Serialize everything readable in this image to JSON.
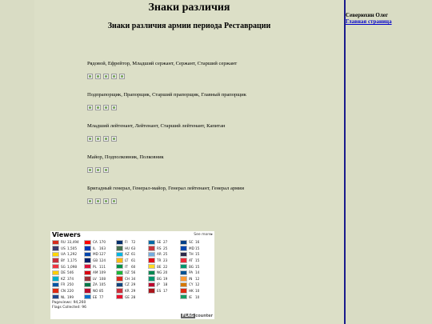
{
  "page": {
    "title": "Знаки различия",
    "subtitle": "Знаки различия армии периода Реставрации"
  },
  "sidebar": {
    "author": "Северюхин Олег",
    "home_link": "Главная страница"
  },
  "ranks": [
    {
      "text": "Рядовой, Ефрейтор, Младший сержант, Сержант, Старший сержант",
      "images": 5
    },
    {
      "text": "Подпрапорщик, Прапорщик, Старший прапорщик, Главный прапорщик",
      "images": 4
    },
    {
      "text": "Младший лейтенант, Лейтенант, Старший лейтенант, Капитан",
      "images": 4
    },
    {
      "text": "Майор, Подполковник, Полковник",
      "images": 3
    },
    {
      "text": "Бригадный генерал, Генерал-майор, Генерал лейтенант, Генерал армии",
      "images": 4
    }
  ],
  "flag_counter": {
    "title": "Viewers",
    "see_more": "See more▸",
    "pageviews_label": "Pageviews:",
    "pageviews": "94,260",
    "flags_label": "Flags Collected:",
    "flags_collected": "96",
    "brand": "FLAG",
    "brand2": "counter",
    "columns": [
      [
        {
          "code": "RU",
          "count": "33,494",
          "color": "#d52b1e"
        },
        {
          "code": "US",
          "count": "1,505",
          "color": "#3c3b6e"
        },
        {
          "code": "UA",
          "count": "1,292",
          "color": "#ffd500"
        },
        {
          "code": "BY",
          "count": "1,175",
          "color": "#c8313e"
        },
        {
          "code": "SG",
          "count": "1,098",
          "color": "#ef3340"
        },
        {
          "code": "DE",
          "count": "546",
          "color": "#ffce00"
        },
        {
          "code": "KZ",
          "count": "374",
          "color": "#00afca"
        },
        {
          "code": "FR",
          "count": "250",
          "color": "#0055a4"
        },
        {
          "code": "CN",
          "count": "220",
          "color": "#de2910"
        },
        {
          "code": "NL",
          "count": "199",
          "color": "#21468b"
        }
      ],
      [
        {
          "code": "CA",
          "count": "170",
          "color": "#ff0000"
        },
        {
          "code": "IL",
          "count": "163",
          "color": "#0038b8"
        },
        {
          "code": "MD",
          "count": "127",
          "color": "#0046ae"
        },
        {
          "code": "GB",
          "count": "124",
          "color": "#012169"
        },
        {
          "code": "PL",
          "count": "111",
          "color": "#dc143c"
        },
        {
          "code": "AM",
          "count": "109",
          "color": "#d90012"
        },
        {
          "code": "LV",
          "count": "108",
          "color": "#9e3039"
        },
        {
          "code": "ZA",
          "count": "105",
          "color": "#007749"
        },
        {
          "code": "NO",
          "count": "85",
          "color": "#ba0c2f"
        },
        {
          "code": "EE",
          "count": "77",
          "color": "#0072ce"
        }
      ],
      [
        {
          "code": "FI",
          "count": "72",
          "color": "#002f6c"
        },
        {
          "code": "HU",
          "count": "63",
          "color": "#477050"
        },
        {
          "code": "AZ",
          "count": "61",
          "color": "#00b5e2"
        },
        {
          "code": "LT",
          "count": "61",
          "color": "#fdb913"
        },
        {
          "code": "IT",
          "count": "60",
          "color": "#009246"
        },
        {
          "code": "UZ",
          "count": "56",
          "color": "#1eb53a"
        },
        {
          "code": "CH",
          "count": "34",
          "color": "#da291c"
        },
        {
          "code": "CZ",
          "count": "29",
          "color": "#11457e"
        },
        {
          "code": "KR",
          "count": "29",
          "color": "#cd2e3a"
        },
        {
          "code": "GE",
          "count": "28",
          "color": "#e8112d"
        }
      ],
      [
        {
          "code": "SE",
          "count": "27",
          "color": "#006aa7"
        },
        {
          "code": "RS",
          "count": "25",
          "color": "#c6363c"
        },
        {
          "code": "AR",
          "count": "25",
          "color": "#74acdf"
        },
        {
          "code": "TR",
          "count": "23",
          "color": "#e30a17"
        },
        {
          "code": "BE",
          "count": "22",
          "color": "#fdda24"
        },
        {
          "code": "NG",
          "count": "20",
          "color": "#008751"
        },
        {
          "code": "BG",
          "count": "19",
          "color": "#00966e"
        },
        {
          "code": "JP",
          "count": "18",
          "color": "#bc002d"
        },
        {
          "code": "ES",
          "count": "17",
          "color": "#aa151b"
        }
      ],
      [
        {
          "code": "SC",
          "count": "16",
          "color": "#003f87"
        },
        {
          "code": "MD",
          "count": "15",
          "color": "#0046ae"
        },
        {
          "code": "TH",
          "count": "15",
          "color": "#2d2a4a"
        },
        {
          "code": "AT",
          "count": "15",
          "color": "#ed2939"
        },
        {
          "code": "BG",
          "count": "15",
          "color": "#00966e"
        },
        {
          "code": "PA",
          "count": "14",
          "color": "#005293"
        },
        {
          "code": "IN",
          "count": "12",
          "color": "#ff9933"
        },
        {
          "code": "CY",
          "count": "12",
          "color": "#d57800"
        },
        {
          "code": "HK",
          "count": "10",
          "color": "#de2910"
        },
        {
          "code": "IE",
          "count": "10",
          "color": "#169b62"
        }
      ]
    ]
  }
}
